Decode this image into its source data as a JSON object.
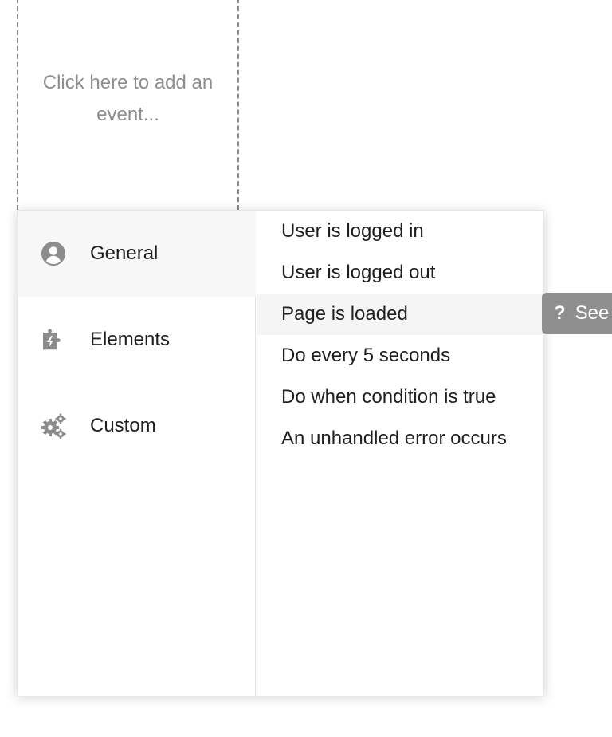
{
  "add_event": {
    "label": "Click here to add an event..."
  },
  "categories": [
    {
      "label": "General",
      "icon": "user-circle-icon",
      "active": true
    },
    {
      "label": "Elements",
      "icon": "puzzle-piece-icon",
      "active": false
    },
    {
      "label": "Custom",
      "icon": "gears-icon",
      "active": false
    }
  ],
  "events": [
    {
      "label": "User is logged in"
    },
    {
      "label": "User is logged out"
    },
    {
      "label": "Page is loaded",
      "hovered": true
    },
    {
      "label": "Do every 5 seconds"
    },
    {
      "label": "Do when condition is true"
    },
    {
      "label": "An unhandled error occurs"
    }
  ],
  "help_button": {
    "icon": "question-icon",
    "label": "See"
  },
  "colors": {
    "icon_gray": "#8c8c8c",
    "help_bg": "#8f8f8f",
    "hover_bg": "#f5f5f5"
  }
}
